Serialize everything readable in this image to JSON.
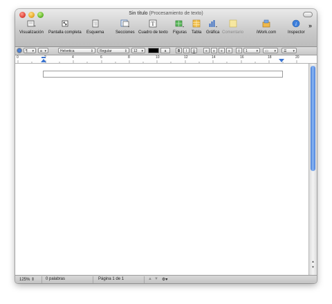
{
  "window": {
    "title": "Sin título",
    "subtitle": "(Procesamiento de texto)"
  },
  "toolbar": {
    "items": [
      {
        "label": "Visualización",
        "icon": "view-icon"
      },
      {
        "label": "Pantalla completa",
        "icon": "fullscreen-icon"
      },
      {
        "label": "Esquema",
        "icon": "outline-icon"
      },
      {
        "label": "Secciones",
        "icon": "sections-icon"
      },
      {
        "label": "Cuadro de texto",
        "icon": "text-box-icon"
      },
      {
        "label": "Figuras",
        "icon": "shapes-icon"
      },
      {
        "label": "Tabla",
        "icon": "table-icon"
      },
      {
        "label": "Gráfica",
        "icon": "chart-icon"
      },
      {
        "label": "Comentario",
        "icon": "comment-icon"
      },
      {
        "label": "iWork.com",
        "icon": "iwork-share-icon"
      },
      {
        "label": "Inspector",
        "icon": "info-icon"
      }
    ],
    "overflow": "»"
  },
  "format_bar": {
    "style_dropdown": "a",
    "font_family": "Helvetica",
    "font_style": "Regular",
    "font_size": "12",
    "text_color": "#000000",
    "highlight_label": "a",
    "bold": "B",
    "italic": "I",
    "underline": "U",
    "line_spacing": "1",
    "columns_value": "1"
  },
  "ruler": {
    "labels": [
      "0",
      "2",
      "4",
      "6",
      "8",
      "10",
      "12",
      "14",
      "16",
      "18",
      "20"
    ]
  },
  "status_bar": {
    "zoom": "125%",
    "word_count": "0 palabras",
    "page_info": "Página 1 de 1"
  }
}
